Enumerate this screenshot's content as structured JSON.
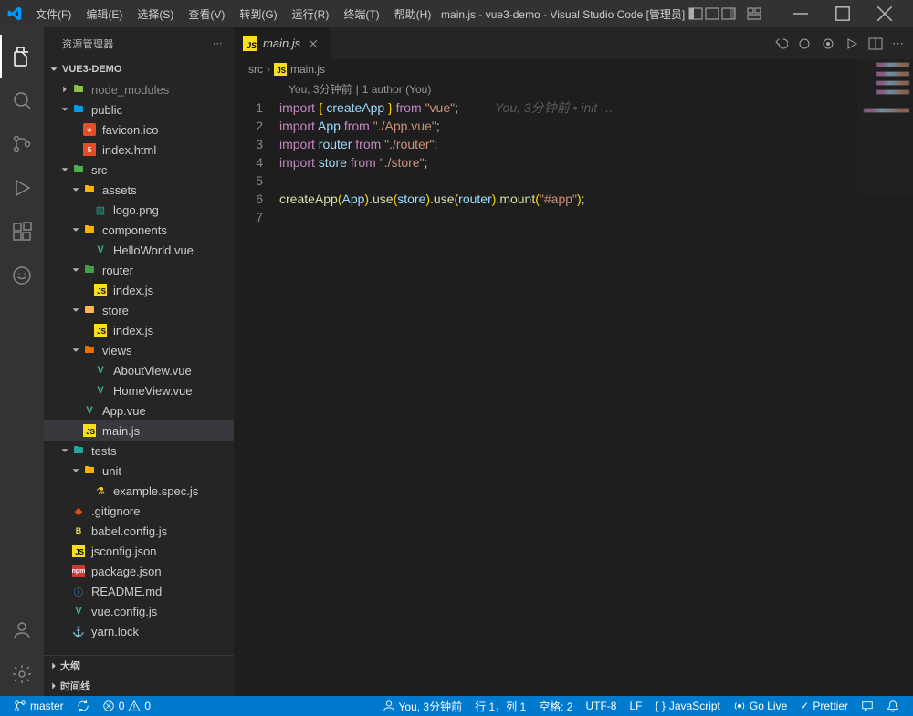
{
  "titlebar": {
    "menus": [
      "文件(F)",
      "编辑(E)",
      "选择(S)",
      "查看(V)",
      "转到(G)",
      "运行(R)",
      "终端(T)",
      "帮助(H)"
    ],
    "title": "main.js - vue3-demo - Visual Studio Code [管理员]"
  },
  "activity": {
    "items": [
      "explorer-icon",
      "search-icon",
      "source-control-icon",
      "run-debug-icon",
      "extensions-icon",
      "test-icon",
      "copilot-icon"
    ],
    "bottom": [
      "account-icon",
      "settings-gear-icon"
    ]
  },
  "sidebar": {
    "header": "资源管理器",
    "root": "VUE3-DEMO",
    "outline": "大纲",
    "timeline": "时间线"
  },
  "tree": [
    {
      "d": 0,
      "t": "folder",
      "open": false,
      "name": "node_modules",
      "icon": "folder-node",
      "dim": true
    },
    {
      "d": 0,
      "t": "folder",
      "open": true,
      "name": "public",
      "icon": "folder-public"
    },
    {
      "d": 1,
      "t": "file",
      "name": "favicon.ico",
      "icon": "favicon"
    },
    {
      "d": 1,
      "t": "file",
      "name": "index.html",
      "icon": "html"
    },
    {
      "d": 0,
      "t": "folder",
      "open": true,
      "name": "src",
      "icon": "folder-src"
    },
    {
      "d": 1,
      "t": "folder",
      "open": true,
      "name": "assets",
      "icon": "folder-assets"
    },
    {
      "d": 2,
      "t": "file",
      "name": "logo.png",
      "icon": "image"
    },
    {
      "d": 1,
      "t": "folder",
      "open": true,
      "name": "components",
      "icon": "folder-components"
    },
    {
      "d": 2,
      "t": "file",
      "name": "HelloWorld.vue",
      "icon": "vue"
    },
    {
      "d": 1,
      "t": "folder",
      "open": true,
      "name": "router",
      "icon": "folder-router"
    },
    {
      "d": 2,
      "t": "file",
      "name": "index.js",
      "icon": "js"
    },
    {
      "d": 1,
      "t": "folder",
      "open": true,
      "name": "store",
      "icon": "folder-store"
    },
    {
      "d": 2,
      "t": "file",
      "name": "index.js",
      "icon": "js"
    },
    {
      "d": 1,
      "t": "folder",
      "open": true,
      "name": "views",
      "icon": "folder-views"
    },
    {
      "d": 2,
      "t": "file",
      "name": "AboutView.vue",
      "icon": "vue"
    },
    {
      "d": 2,
      "t": "file",
      "name": "HomeView.vue",
      "icon": "vue"
    },
    {
      "d": 1,
      "t": "file",
      "name": "App.vue",
      "icon": "vue"
    },
    {
      "d": 1,
      "t": "file",
      "name": "main.js",
      "icon": "js",
      "selected": true
    },
    {
      "d": 0,
      "t": "folder",
      "open": true,
      "name": "tests",
      "icon": "folder-tests"
    },
    {
      "d": 1,
      "t": "folder",
      "open": true,
      "name": "unit",
      "icon": "folder-unit"
    },
    {
      "d": 2,
      "t": "file",
      "name": "example.spec.js",
      "icon": "testjs"
    },
    {
      "d": 0,
      "t": "file",
      "name": ".gitignore",
      "icon": "git"
    },
    {
      "d": 0,
      "t": "file",
      "name": "babel.config.js",
      "icon": "babel"
    },
    {
      "d": 0,
      "t": "file",
      "name": "jsconfig.json",
      "icon": "jsconfig"
    },
    {
      "d": 0,
      "t": "file",
      "name": "package.json",
      "icon": "npm"
    },
    {
      "d": 0,
      "t": "file",
      "name": "README.md",
      "icon": "readme"
    },
    {
      "d": 0,
      "t": "file",
      "name": "vue.config.js",
      "icon": "vueconf"
    },
    {
      "d": 0,
      "t": "file",
      "name": "yarn.lock",
      "icon": "yarn"
    }
  ],
  "tab": {
    "name": "main.js"
  },
  "breadcrumb": {
    "parts": [
      "src",
      "main.js"
    ]
  },
  "codelens": {
    "author": "You, 3分钟前",
    "rest": "1 author (You)"
  },
  "gitlens_inline": "You, 3分钟前 • init …",
  "code_lines": [
    1,
    2,
    3,
    4,
    5,
    6,
    7
  ],
  "code": {
    "l1": {
      "a": "import",
      "b": "{",
      "c": "createApp",
      "d": "}",
      "e": "from",
      "f": "\"vue\"",
      "g": ";"
    },
    "l2": {
      "a": "import",
      "b": "App",
      "c": "from",
      "d": "\"./App.vue\"",
      "e": ";"
    },
    "l3": {
      "a": "import",
      "b": "router",
      "c": "from",
      "d": "\"./router\"",
      "e": ";"
    },
    "l4": {
      "a": "import",
      "b": "store",
      "c": "from",
      "d": "\"./store\"",
      "e": ";"
    },
    "l6": {
      "a": "createApp",
      "b": "(",
      "c": "App",
      "d": ")",
      "e": ".",
      "f": "use",
      "g": "(",
      "h": "store",
      "i": ")",
      "j": ".",
      "k": "use",
      "l": "(",
      "m": "router",
      "n": ")",
      "o": ".",
      "p": "mount",
      "q": "(",
      "r": "\"#app\"",
      "s": ")",
      "t": ";"
    }
  },
  "status": {
    "branch": "master",
    "sync": "",
    "errors": "0",
    "warnings": "0",
    "blame": "You, 3分钟前",
    "pos": "行 1，列 1",
    "spaces": "空格: 2",
    "encoding": "UTF-8",
    "eol": "LF",
    "lang": "JavaScript",
    "golive": "Go Live",
    "prettier": "Prettier"
  }
}
